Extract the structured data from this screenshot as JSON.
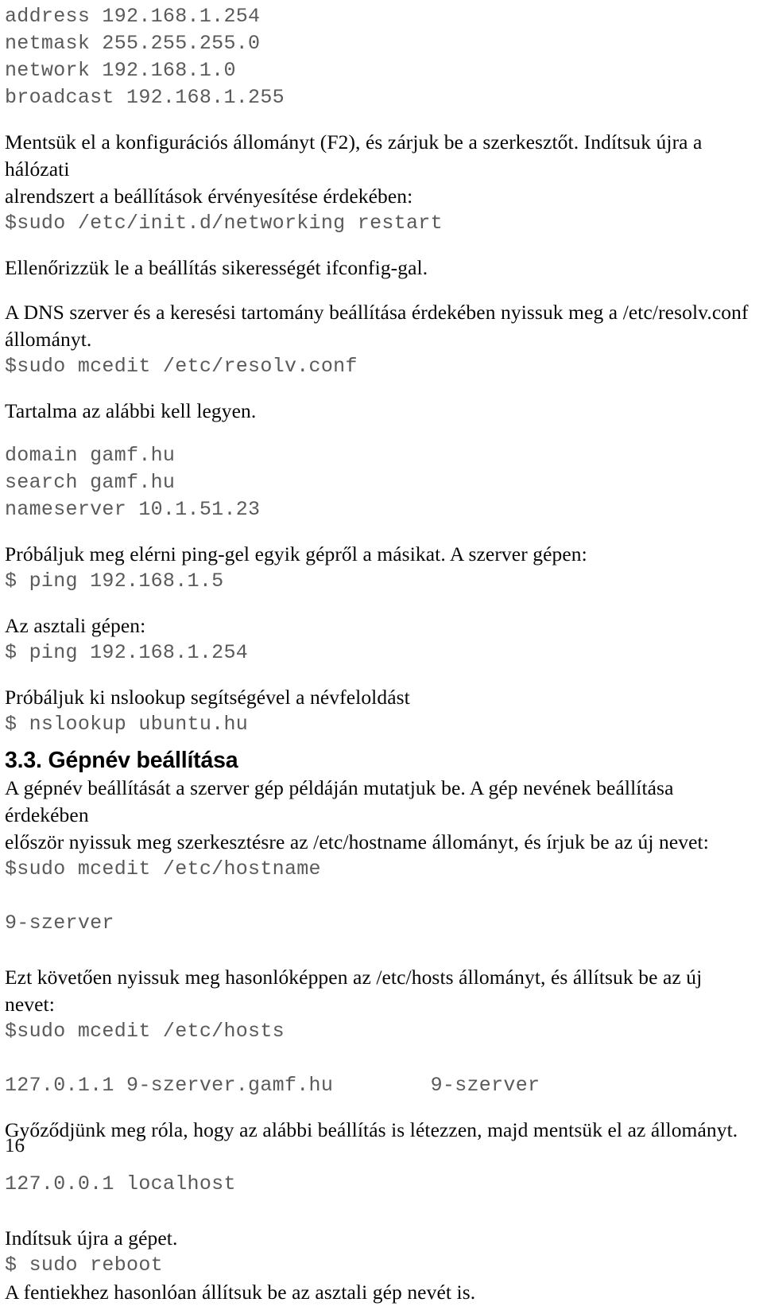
{
  "document": {
    "language": "hu",
    "page_number": "16",
    "text_color": "#060606",
    "code_color": "#5a5a5a",
    "background": "#ffffff"
  },
  "blocks": {
    "interfaces_config": {
      "line1": "address 192.168.1.254",
      "line2": "netmask 255.255.255.0",
      "line3": "network 192.168.1.0",
      "line4": "broadcast 192.168.1.255"
    },
    "save_restart_paragraph": "Mentsük el a konfigurációs állományt (F2), és zárjuk be a szerkesztőt. Indítsuk újra a hálózati\nalrendszert a beállítások érvényesítése érdekében:",
    "cmd_networking_restart": "$sudo /etc/init.d/networking restart",
    "verify_ifconfig_paragraph": "Ellenőrizzük le a beállítás sikerességét ifconfig-gal.",
    "dns_intro_paragraph": "A DNS szerver és a keresési tartomány beállítása érdekében nyissuk meg a /etc/resolv.conf\nállományt.",
    "cmd_mcedit_resolv": "$sudo mcedit /etc/resolv.conf",
    "contents_should_be_paragraph": "Tartalma az alábbi kell legyen.",
    "resolv_conf": {
      "line1": "domain gamf.hu",
      "line2": "search gamf.hu",
      "line3": "nameserver 10.1.51.23"
    },
    "ping_intro_paragraph": "Próbáljuk meg elérni ping-gel egyik gépről a másikat. A szerver gépen:",
    "cmd_ping_server": "$ ping 192.168.1.5",
    "desktop_machine_paragraph": "Az asztali gépen:",
    "cmd_ping_desktop": "$ ping 192.168.1.254",
    "nslookup_paragraph": "Próbáljuk ki nslookup segítségével a névfeloldást",
    "cmd_nslookup": "$ nslookup ubuntu.hu",
    "section_heading": "3.3. Gépnév beállítása",
    "hostname_intro_paragraph": "A gépnév beállítását a szerver gép példáján mutatjuk be. A gép nevének beállítása érdekében\nelőször nyissuk meg szerkesztésre az /etc/hostname állományt, és írjuk be az új nevet:",
    "cmd_mcedit_hostname": "$sudo mcedit /etc/hostname",
    "hostname_value": "9-szerver",
    "hosts_intro_paragraph": "Ezt követően nyissuk meg hasonlóképpen az /etc/hosts állományt, és állítsuk be az új nevet:",
    "cmd_mcedit_hosts": "$sudo mcedit /etc/hosts",
    "hosts_entry": "127.0.1.1 9-szerver.gamf.hu        9-szerver",
    "localhost_check_paragraph": "Győződjünk meg róla, hogy az alábbi beállítás is létezzen, majd mentsük el az állományt.",
    "hosts_localhost_entry": "127.0.0.1 localhost",
    "reboot_paragraph": "Indítsuk újra a gépet.",
    "cmd_reboot": "$ sudo reboot",
    "desktop_hostname_paragraph": "A fentiekhez hasonlóan állítsuk be az asztali gép nevét is."
  }
}
